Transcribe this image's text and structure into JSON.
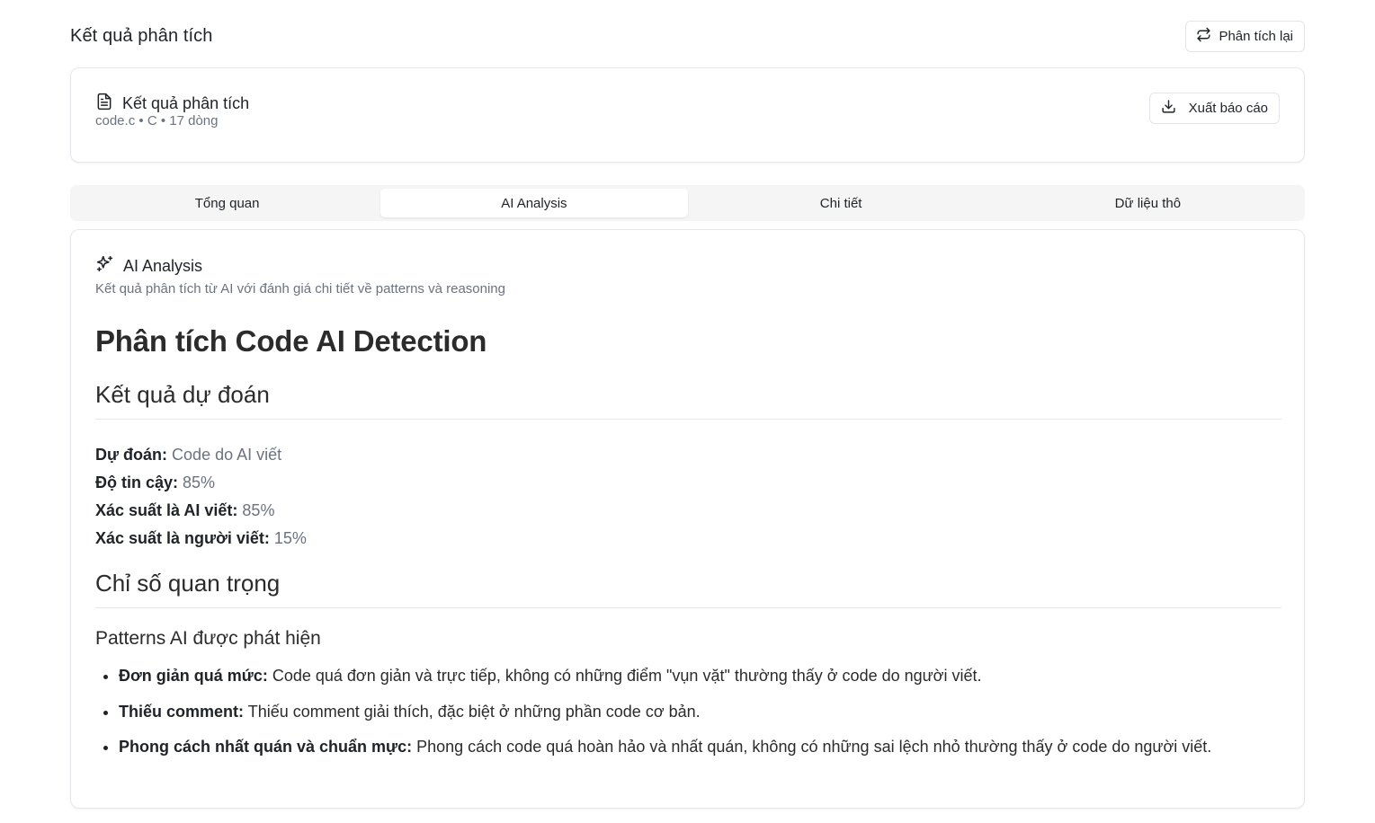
{
  "header": {
    "title": "Kết quả phân tích",
    "reanalyze_label": "Phân tích lại"
  },
  "file_card": {
    "title": "Kết quả phân tích",
    "filename": "code.c",
    "language": "C",
    "lines": "17 dòng",
    "separator": "•",
    "export_label": "Xuất báo cáo"
  },
  "tabs": [
    {
      "label": "Tổng quan",
      "active": false
    },
    {
      "label": "AI Analysis",
      "active": true
    },
    {
      "label": "Chi tiết",
      "active": false
    },
    {
      "label": "Dữ liệu thô",
      "active": false
    }
  ],
  "analysis": {
    "title": "AI Analysis",
    "subtitle": "Kết quả phân tích từ AI với đánh giá chi tiết về patterns và reasoning",
    "h1": "Phân tích Code AI Detection",
    "section_prediction": "Kết quả dự đoán",
    "stats": [
      {
        "label": "Dự đoán:",
        "value": "Code do AI viết"
      },
      {
        "label": "Độ tin cậy:",
        "value": "85%"
      },
      {
        "label": "Xác suất là AI viết:",
        "value": "85%"
      },
      {
        "label": "Xác suất là người viết:",
        "value": "15%"
      }
    ],
    "section_metrics": "Chỉ số quan trọng",
    "subsection_patterns": "Patterns AI được phát hiện",
    "patterns": [
      {
        "label": "Đơn giản quá mức:",
        "text": "Code quá đơn giản và trực tiếp, không có những điểm \"vụn vặt\" thường thấy ở code do người viết."
      },
      {
        "label": "Thiếu comment:",
        "text": "Thiếu comment giải thích, đặc biệt ở những phần code cơ bản."
      },
      {
        "label": "Phong cách nhất quán và chuẩn mực:",
        "text": "Phong cách code quá hoàn hảo và nhất quán, không có những sai lệch nhỏ thường thấy ở code do người viết."
      }
    ]
  },
  "icons": {
    "reanalyze": "arrows-repeat-icon",
    "file": "file-text-icon",
    "export": "download-icon",
    "ai": "sparkles-icon"
  }
}
